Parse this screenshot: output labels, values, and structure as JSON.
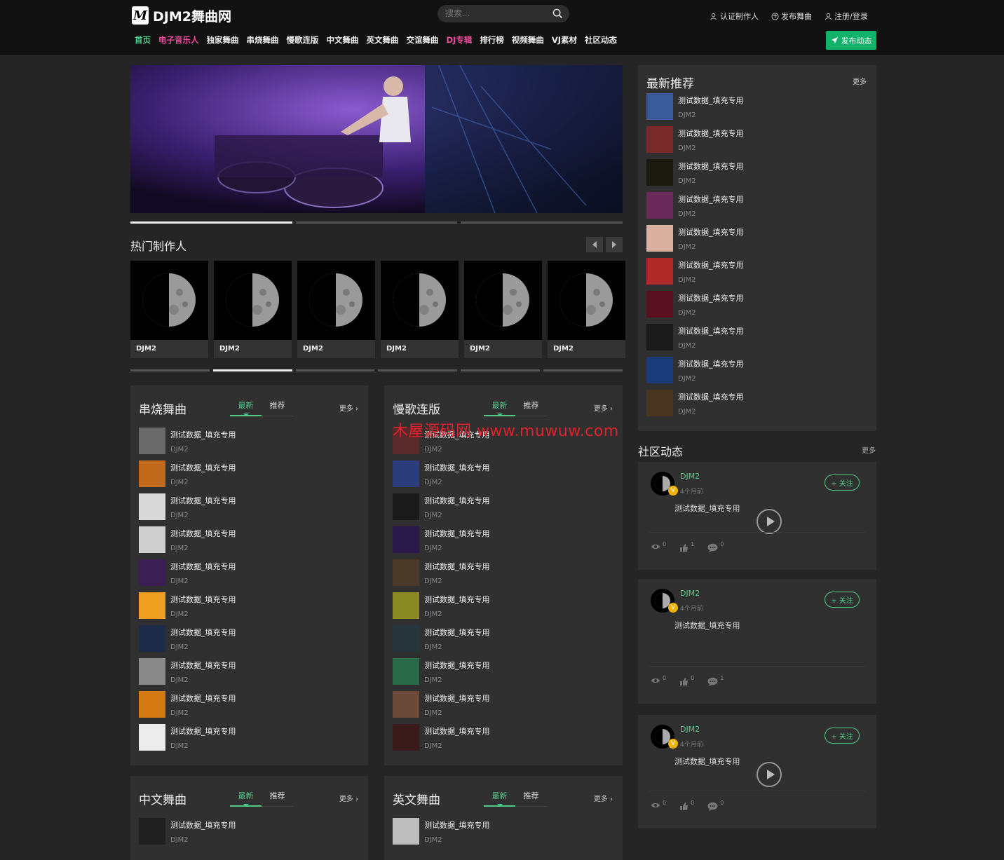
{
  "header": {
    "logo_mark": "M",
    "site_name": "DJM2舞曲网",
    "search_placeholder": "搜索...",
    "user_links": [
      "认证制作人",
      "发布舞曲",
      "注册/登录"
    ],
    "nav": [
      {
        "label": "首页",
        "style": "green"
      },
      {
        "label": "电子音乐人",
        "style": "pink"
      },
      {
        "label": "独家舞曲",
        "style": ""
      },
      {
        "label": "串烧舞曲",
        "style": ""
      },
      {
        "label": "慢歌连版",
        "style": ""
      },
      {
        "label": "中文舞曲",
        "style": ""
      },
      {
        "label": "英文舞曲",
        "style": ""
      },
      {
        "label": "交谊舞曲",
        "style": ""
      },
      {
        "label": "DJ专辑",
        "style": "pink"
      },
      {
        "label": "排行榜",
        "style": ""
      },
      {
        "label": "视频舞曲",
        "style": ""
      },
      {
        "label": "VJ素材",
        "style": ""
      },
      {
        "label": "社区动态",
        "style": ""
      }
    ],
    "publish_label": "发布动态"
  },
  "hot_makers": {
    "title": "热门制作人",
    "items": [
      "DJM2",
      "DJM2",
      "DJM2",
      "DJM2",
      "DJM2",
      "DJM2"
    ]
  },
  "panels": [
    {
      "title": "串烧舞曲",
      "tabs": [
        "最新",
        "推荐"
      ],
      "more": "更多",
      "items": [
        {
          "title": "测试数据_填充专用",
          "sub": "DJM2",
          "cover": "#6a6a6a"
        },
        {
          "title": "测试数据_填充专用",
          "sub": "DJM2",
          "cover": "#c26a1c"
        },
        {
          "title": "测试数据_填充专用",
          "sub": "DJM2",
          "cover": "#d9d9d9"
        },
        {
          "title": "测试数据_填充专用",
          "sub": "DJM2",
          "cover": "#cfcfcf"
        },
        {
          "title": "测试数据_填充专用",
          "sub": "DJM2",
          "cover": "#3a1f55"
        },
        {
          "title": "测试数据_填充专用",
          "sub": "DJM2",
          "cover": "#f0a020"
        },
        {
          "title": "测试数据_填充专用",
          "sub": "DJM2",
          "cover": "#1e2b48"
        },
        {
          "title": "测试数据_填充专用",
          "sub": "DJM2",
          "cover": "#8a8a8a"
        },
        {
          "title": "测试数据_填充专用",
          "sub": "DJM2",
          "cover": "#d37a12"
        },
        {
          "title": "测试数据_填充专用",
          "sub": "DJM2",
          "cover": "#ececec"
        }
      ]
    },
    {
      "title": "慢歌连版",
      "tabs": [
        "最新",
        "推荐"
      ],
      "more": "更多",
      "items": [
        {
          "title": "测试数据_填充专用",
          "sub": "DJM2",
          "cover": "#5a2a2a"
        },
        {
          "title": "测试数据_填充专用",
          "sub": "DJM2",
          "cover": "#2b3d7a"
        },
        {
          "title": "测试数据_填充专用",
          "sub": "DJM2",
          "cover": "#1a1a1a"
        },
        {
          "title": "测试数据_填充专用",
          "sub": "DJM2",
          "cover": "#2a1a4a"
        },
        {
          "title": "测试数据_填充专用",
          "sub": "DJM2",
          "cover": "#4a3a2a"
        },
        {
          "title": "测试数据_填充专用",
          "sub": "DJM2",
          "cover": "#8a8a22"
        },
        {
          "title": "测试数据_填充专用",
          "sub": "DJM2",
          "cover": "#26363a"
        },
        {
          "title": "测试数据_填充专用",
          "sub": "DJM2",
          "cover": "#2a6a4a"
        },
        {
          "title": "测试数据_填充专用",
          "sub": "DJM2",
          "cover": "#6a4a3a"
        },
        {
          "title": "测试数据_填充专用",
          "sub": "DJM2",
          "cover": "#3a1a1a"
        }
      ]
    },
    {
      "title": "中文舞曲",
      "tabs": [
        "最新",
        "推荐"
      ],
      "more": "更多",
      "items": [
        {
          "title": "测试数据_填充专用",
          "sub": "DJM2",
          "cover": "#202020"
        }
      ]
    },
    {
      "title": "英文舞曲",
      "tabs": [
        "最新",
        "推荐"
      ],
      "more": "更多",
      "items": [
        {
          "title": "测试数据_填充专用",
          "sub": "DJM2",
          "cover": "#bdbdbd"
        }
      ]
    }
  ],
  "recommend": {
    "title": "最新推荐",
    "more": "更多",
    "items": [
      {
        "title": "测试数据_填充专用",
        "sub": "DJM2",
        "cover": "#3a5a9a"
      },
      {
        "title": "测试数据_填充专用",
        "sub": "DJM2",
        "cover": "#7a2a2a"
      },
      {
        "title": "测试数据_填充专用",
        "sub": "DJM2",
        "cover": "#1a1a10"
      },
      {
        "title": "测试数据_填充专用",
        "sub": "DJM2",
        "cover": "#6a2a5a"
      },
      {
        "title": "测试数据_填充专用",
        "sub": "DJM2",
        "cover": "#d9b0a0"
      },
      {
        "title": "测试数据_填充专用",
        "sub": "DJM2",
        "cover": "#b02a2a"
      },
      {
        "title": "测试数据_填充专用",
        "sub": "DJM2",
        "cover": "#5a1020"
      },
      {
        "title": "测试数据_填充专用",
        "sub": "DJM2",
        "cover": "#1a1a1a"
      },
      {
        "title": "测试数据_填充专用",
        "sub": "DJM2",
        "cover": "#1a3a7a"
      },
      {
        "title": "测试数据_填充专用",
        "sub": "DJM2",
        "cover": "#4a3520"
      }
    ]
  },
  "community": {
    "title": "社区动态",
    "more": "更多",
    "posts": [
      {
        "user": "DJM2",
        "time": "4个月前",
        "follow": "+ 关注",
        "text": "测试数据_填充专用",
        "has_audio": true,
        "views": "0",
        "likes": "1",
        "comments": "0"
      },
      {
        "user": "DJM2",
        "time": "4个月前",
        "follow": "+ 关注",
        "text": "测试数据_填充专用",
        "has_audio": false,
        "views": "0",
        "likes": "0",
        "comments": "1"
      },
      {
        "user": "DJM2",
        "time": "4个月前",
        "follow": "+ 关注",
        "text": "测试数据_填充专用",
        "has_audio": true,
        "views": "0",
        "likes": "0",
        "comments": "0"
      }
    ]
  },
  "watermark": "木屋源码网 www.muwuw.com",
  "colors": {
    "accent": "#4ecb89",
    "pink": "#f1499f",
    "publish": "#12b26b",
    "bg": "#252525",
    "panel": "#303030"
  }
}
